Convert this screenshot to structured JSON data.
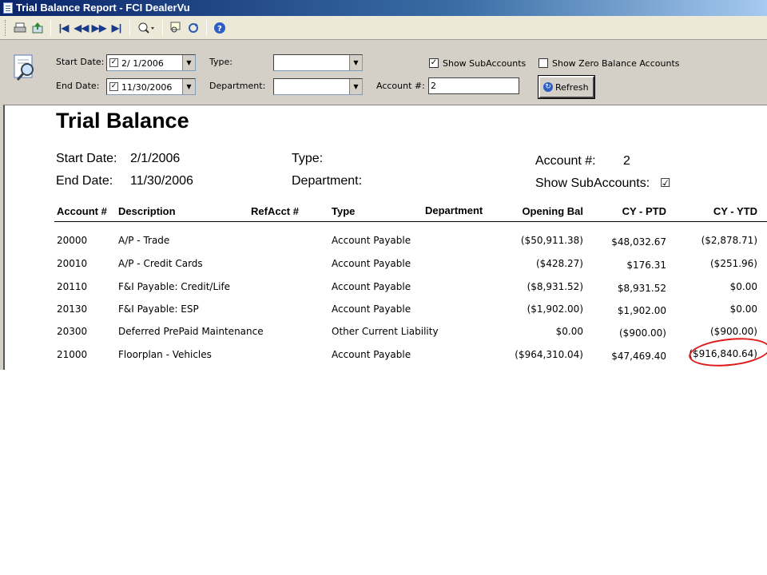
{
  "window": {
    "title": "Trial Balance Report - FCI DealerVu"
  },
  "params": {
    "start_date_label": "Start Date:",
    "start_date_value": "2/  1/2006",
    "end_date_label": "End Date:",
    "end_date_value": "11/30/2006",
    "type_label": "Type:",
    "type_value": "",
    "department_label": "Department:",
    "department_value": "",
    "account_label": "Account #:",
    "account_value": "2",
    "show_sub_label": "Show SubAccounts",
    "show_sub_checked": "✓",
    "show_zero_label": "Show Zero Balance Accounts",
    "show_zero_checked": "",
    "refresh_label": "Refresh"
  },
  "report": {
    "title": "Trial Balance",
    "start_date_label": "Start Date:",
    "start_date_value": "2/1/2006",
    "end_date_label": "End Date:",
    "end_date_value": "11/30/2006",
    "type_label": "Type:",
    "department_label": "Department:",
    "account_label": "Account #:",
    "account_value": "2",
    "show_sub_label": "Show SubAccounts:",
    "show_sub_mark": "☑",
    "columns": {
      "account": "Account #",
      "description": "Description",
      "refacct": "RefAcct #",
      "type": "Type",
      "department": "Department",
      "opening": "Opening Bal",
      "ptd": "CY - PTD",
      "ytd": "CY - YTD"
    },
    "rows": [
      {
        "account": "20000",
        "description": "A/P - Trade",
        "type": "Account Payable",
        "opening": "($50,911.38)",
        "ptd": "$48,032.67",
        "ytd": "($2,878.71)"
      },
      {
        "account": "20010",
        "description": "A/P - Credit Cards",
        "type": "Account Payable",
        "opening": "($428.27)",
        "ptd": "$176.31",
        "ytd": "($251.96)"
      },
      {
        "account": "20110",
        "description": "F&I Payable: Credit/Life",
        "type": "Account Payable",
        "opening": "($8,931.52)",
        "ptd": "$8,931.52",
        "ytd": "$0.00"
      },
      {
        "account": "20130",
        "description": "F&I Payable: ESP",
        "type": "Account Payable",
        "opening": "($1,902.00)",
        "ptd": "$1,902.00",
        "ytd": "$0.00"
      },
      {
        "account": "20300",
        "description": "Deferred PrePaid Maintenance",
        "type": "Other Current Liability",
        "opening": "$0.00",
        "ptd": "($900.00)",
        "ytd": "($900.00)"
      },
      {
        "account": "21000",
        "description": "Floorplan - Vehicles",
        "type": "Account Payable",
        "opening": "($964,310.04)",
        "ptd": "$47,469.40",
        "ytd": "($916,840.64)"
      }
    ]
  },
  "annotation": {
    "color": "#e01818"
  }
}
